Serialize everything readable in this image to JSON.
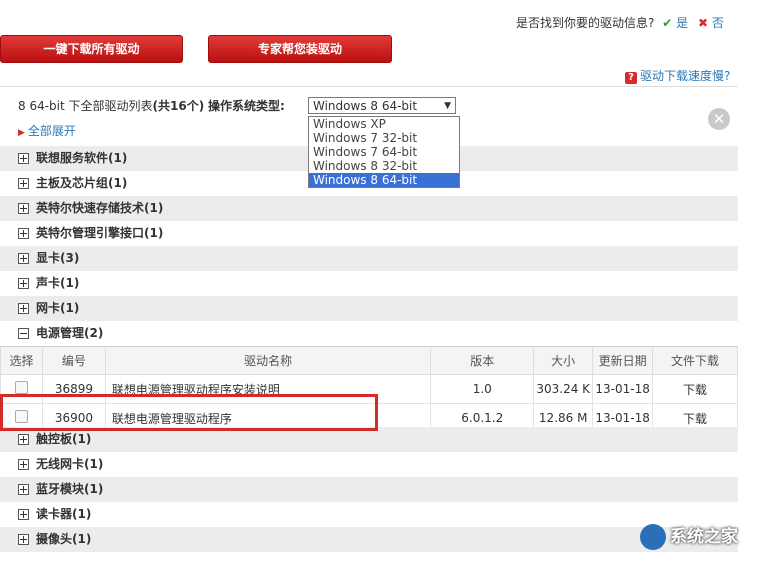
{
  "feedback": {
    "question": "是否找到你要的驱动信息?",
    "yes": "是",
    "no": "否"
  },
  "buttons": {
    "download_all": "一键下载所有驱动",
    "expert": "专家帮您装驱动"
  },
  "speed_link": "驱动下载速度慢?",
  "list_header": {
    "prefix": "8 64-bit 下全部驱动列表",
    "count": "(共16个)",
    "os_label": "操作系统类型:"
  },
  "os_select": {
    "value": "Windows 8 64-bit",
    "options": [
      "Windows XP",
      "Windows 7 32-bit",
      "Windows 7 64-bit",
      "Windows 8 32-bit",
      "Windows 8 64-bit"
    ]
  },
  "expand_all": "全部展开",
  "categories_top": [
    "联想服务软件(1)",
    "主板及芯片组(1)",
    "英特尔快速存储技术(1)",
    "英特尔管理引擎接口(1)",
    "显卡(3)",
    "声卡(1)",
    "网卡(1)"
  ],
  "expanded_category": "电源管理(2)",
  "table": {
    "headers": [
      "选择",
      "编号",
      "驱动名称",
      "版本",
      "大小",
      "更新日期",
      "文件下载"
    ],
    "rows": [
      {
        "id": "36899",
        "name": "联想电源管理驱动程序安装说明",
        "version": "1.0",
        "size": "303.24 K",
        "date": "13-01-18",
        "download": "下载"
      },
      {
        "id": "36900",
        "name": "联想电源管理驱动程序",
        "version": "6.0.1.2",
        "size": "12.86 M",
        "date": "13-01-18",
        "download": "下载"
      }
    ]
  },
  "categories_bottom": [
    "触控板(1)",
    "无线网卡(1)",
    "蓝牙模块(1)",
    "读卡器(1)",
    "摄像头(1)"
  ],
  "watermark": "系统之家",
  "colors": {
    "accent_red": "#d62b2b",
    "link_blue": "#2a7ab8",
    "selected_option": "#3a6fd8"
  }
}
